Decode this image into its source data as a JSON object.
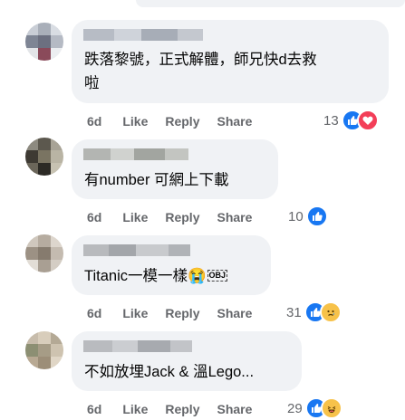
{
  "colors": {
    "bubble": "#f0f2f5",
    "meta": "#65676b",
    "like_blue": "#1877f2",
    "text": "#050505"
  },
  "comments": [
    {
      "text_lines": [
        "跌落黎號，正式解體，師兄快d去救",
        "啦"
      ],
      "time": "6d",
      "like": "Like",
      "reply": "Reply",
      "share": "Share",
      "count": "13",
      "reactions": [
        "like-icon",
        "love-icon"
      ]
    },
    {
      "text_lines": [
        "有number 可網上下載"
      ],
      "time": "6d",
      "like": "Like",
      "reply": "Reply",
      "share": "Share",
      "count": "10",
      "reactions": [
        "like-icon"
      ]
    },
    {
      "text_lines": [
        "Titanic一模一樣"
      ],
      "emoji": "😭",
      "obj": "OBJ",
      "time": "6d",
      "like": "Like",
      "reply": "Reply",
      "share": "Share",
      "count": "31",
      "reactions": [
        "like-icon",
        "sad-icon"
      ]
    },
    {
      "text_lines": [
        "不如放埋Jack & 溫Lego..."
      ],
      "time": "6d",
      "like": "Like",
      "reply": "Reply",
      "share": "Share",
      "count": "29",
      "reactions": [
        "like-icon",
        "haha-icon"
      ]
    }
  ]
}
